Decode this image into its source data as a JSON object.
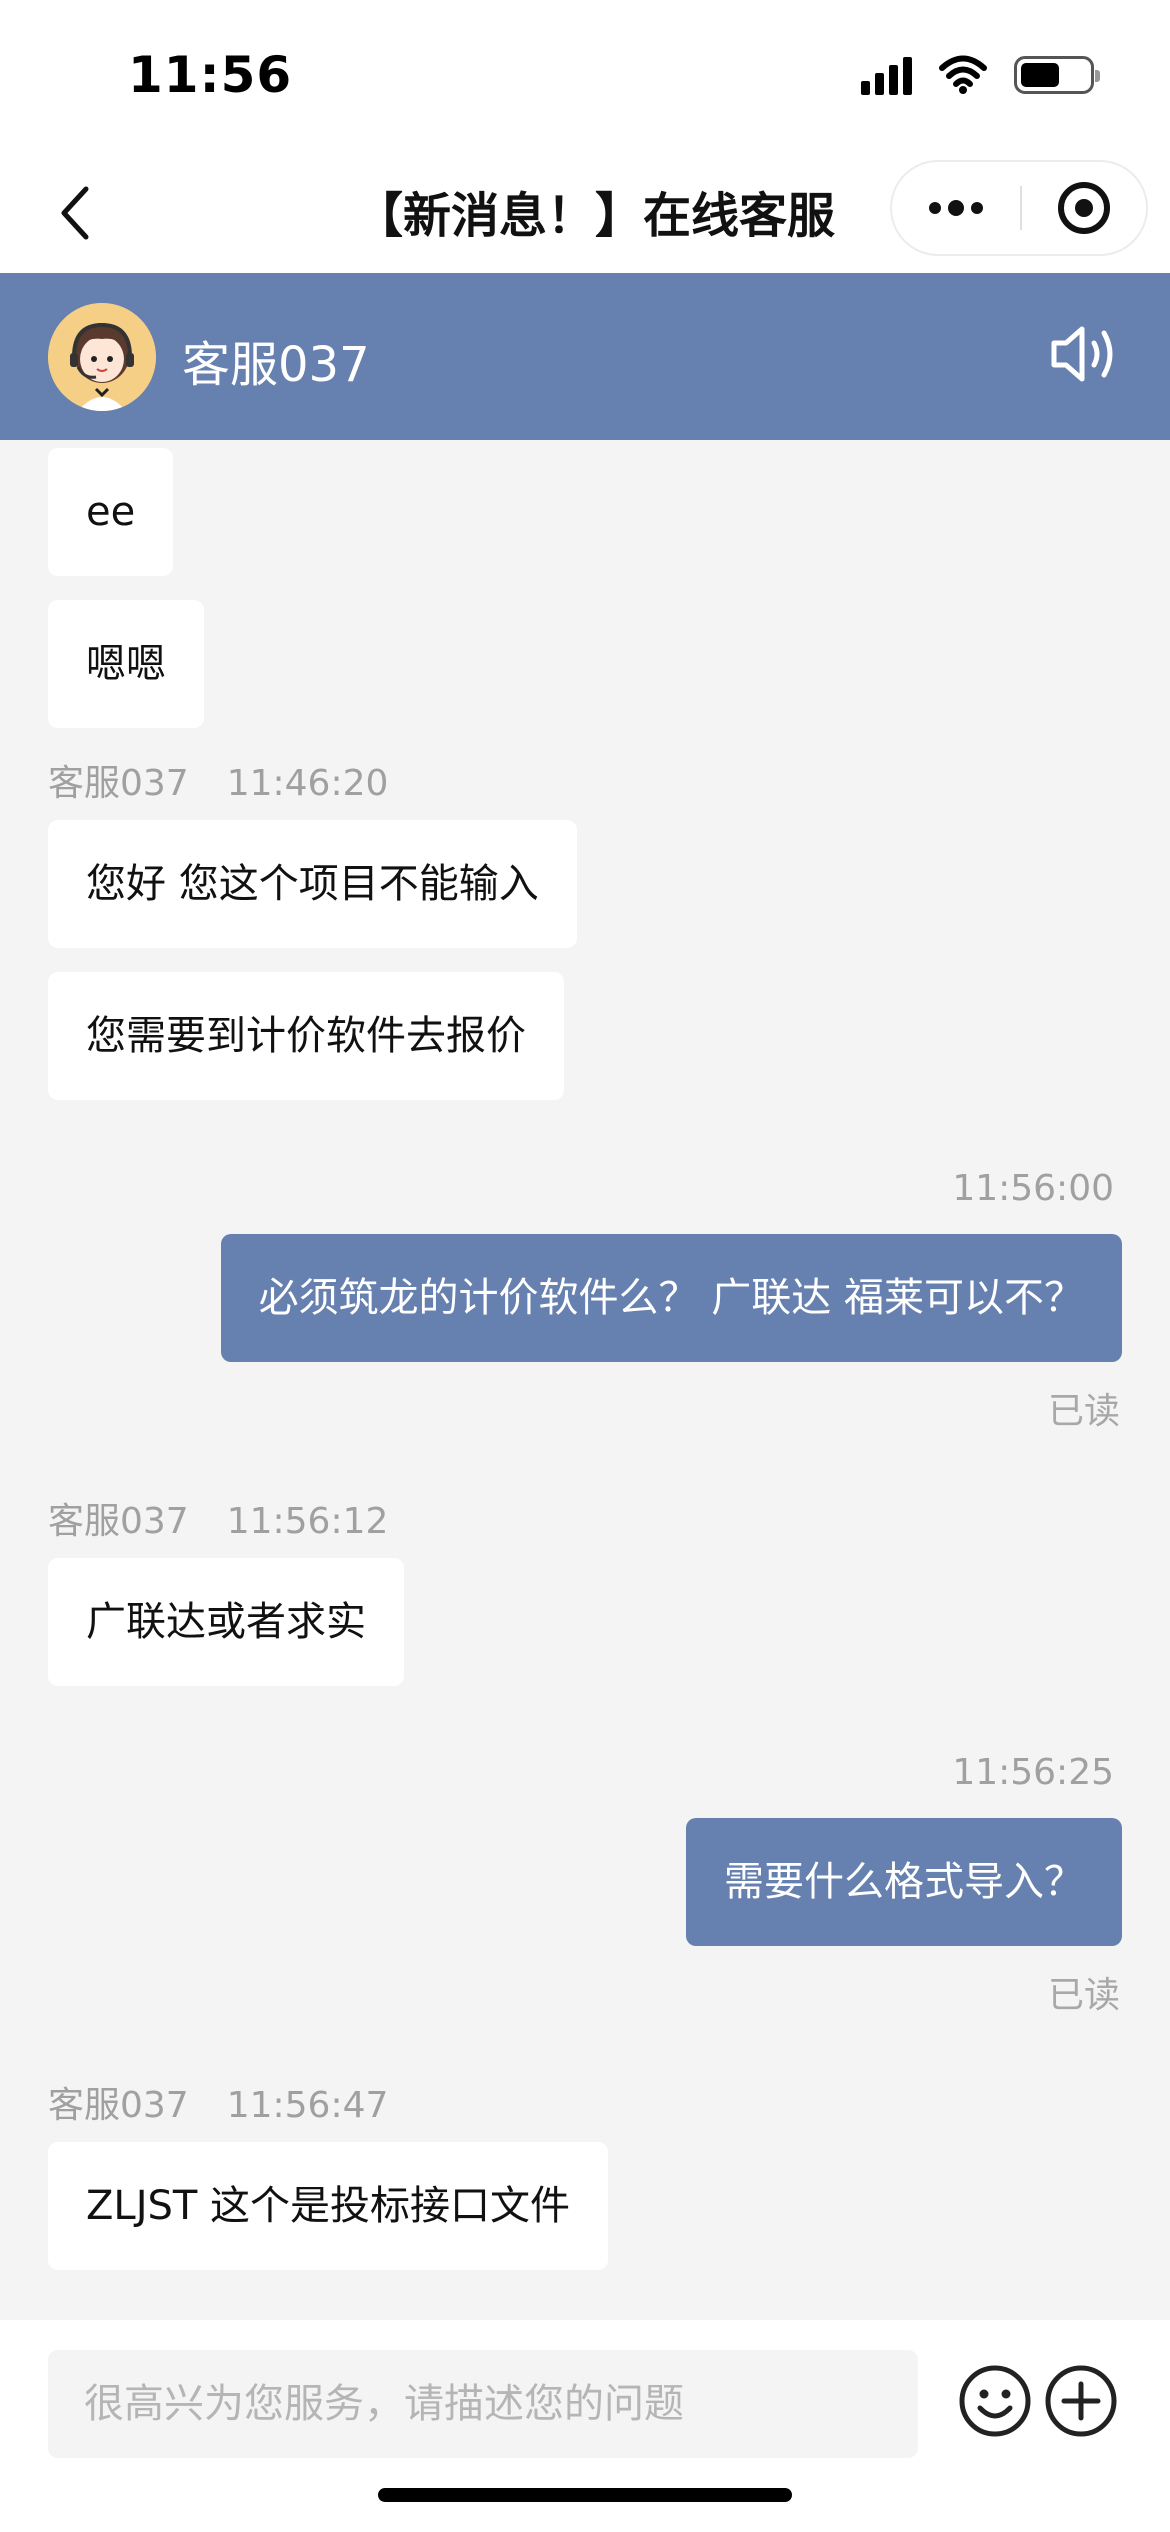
{
  "status_bar": {
    "time": "11:56"
  },
  "nav": {
    "title": "【新消息！】在线客服"
  },
  "agent": {
    "name": "客服037"
  },
  "messages": {
    "m1": {
      "text": "ee"
    },
    "m2": {
      "text": "嗯嗯"
    },
    "meta1": {
      "sender": "客服037",
      "time": "11:46:20"
    },
    "m3": {
      "text": "您好 您这个项目不能输入"
    },
    "m4": {
      "text": "您需要到计价软件去报价"
    },
    "time_out1": "11:56:00",
    "m5": {
      "text": "必须筑龙的计价软件么？ 广联达 福莱可以不？"
    },
    "read1": "已读",
    "meta2": {
      "sender": "客服037",
      "time": "11:56:12"
    },
    "m6": {
      "text": "广联达或者求实"
    },
    "time_out2": "11:56:25",
    "m7": {
      "text": "需要什么格式导入？"
    },
    "read2": "已读",
    "meta3": {
      "sender": "客服037",
      "time": "11:56:47"
    },
    "m8": {
      "text": "ZLJST 这个是投标接口文件"
    }
  },
  "input": {
    "placeholder": "很高兴为您服务，请描述您的问题"
  },
  "colors": {
    "accent": "#6680b0",
    "background": "#f4f4f5",
    "bubble_in": "#ffffff"
  },
  "icons": {
    "back": "chevron-left-icon",
    "more": "more-dots-icon",
    "close": "target-close-icon",
    "speaker": "speaker-icon",
    "emoji": "emoji-icon",
    "plus": "plus-icon"
  }
}
